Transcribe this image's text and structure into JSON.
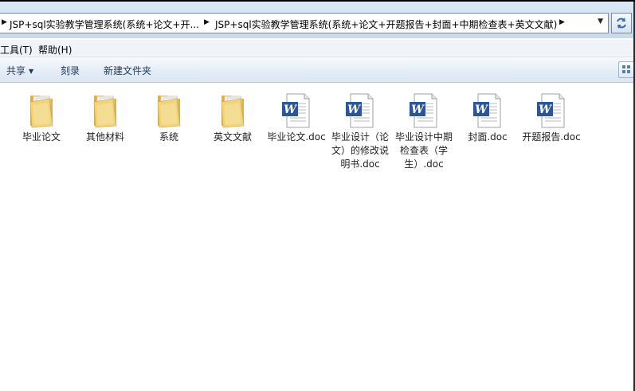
{
  "addressbar": {
    "crumbs": [
      "JSP+sql实验教学管理系统(系统+论文+开...",
      "JSP+sql实验教学管理系统(系统+论文+开题报告+封面+中期检查表+英文文献)"
    ]
  },
  "menubar": {
    "tools_label": "工具(T)",
    "help_label": "帮助(H)"
  },
  "toolbar": {
    "share_label": "共享",
    "burn_label": "刻录",
    "new_folder_label": "新建文件夹"
  },
  "files": [
    {
      "name": "毕业论文",
      "type": "folder"
    },
    {
      "name": "其他材料",
      "type": "folder"
    },
    {
      "name": "系统",
      "type": "folder"
    },
    {
      "name": "英文文献",
      "type": "folder"
    },
    {
      "name": "毕业论文.doc",
      "type": "word-doc"
    },
    {
      "name": "毕业设计（论文）的修改说明书.doc",
      "type": "word-doc"
    },
    {
      "name": "毕业设计中期检查表（学生）.doc",
      "type": "word-doc"
    },
    {
      "name": "封面.doc",
      "type": "word-doc"
    },
    {
      "name": "开题报告.doc",
      "type": "word-doc"
    }
  ]
}
